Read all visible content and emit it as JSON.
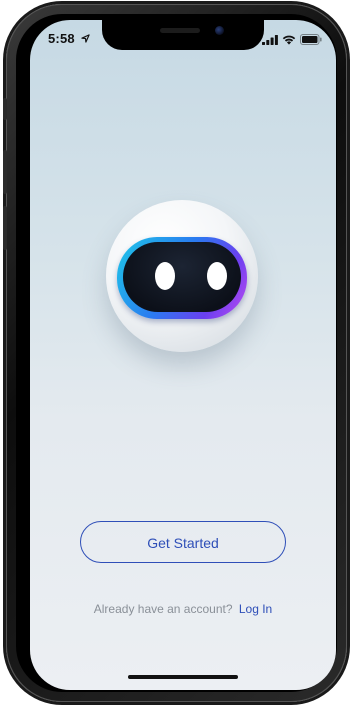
{
  "status_bar": {
    "time": "5:58",
    "icons": [
      "location-arrow-icon",
      "cellular-signal-icon",
      "wifi-icon",
      "battery-icon"
    ]
  },
  "mascot": {
    "icon": "robot-mascot-icon",
    "colors": {
      "visor_start": "#1ec8e8",
      "visor_mid": "#2a7bf0",
      "visor_end": "#c04bf0",
      "face": "#0c1019",
      "eyes": "#ffffff"
    }
  },
  "actions": {
    "get_started_label": "Get Started"
  },
  "login": {
    "prompt": "Already have an account?",
    "link_label": "Log In"
  },
  "theme": {
    "accent": "#2f4fb8",
    "muted_text": "#8a9098",
    "background_top": "#c6d9e4",
    "background_bottom": "#eceff3"
  }
}
